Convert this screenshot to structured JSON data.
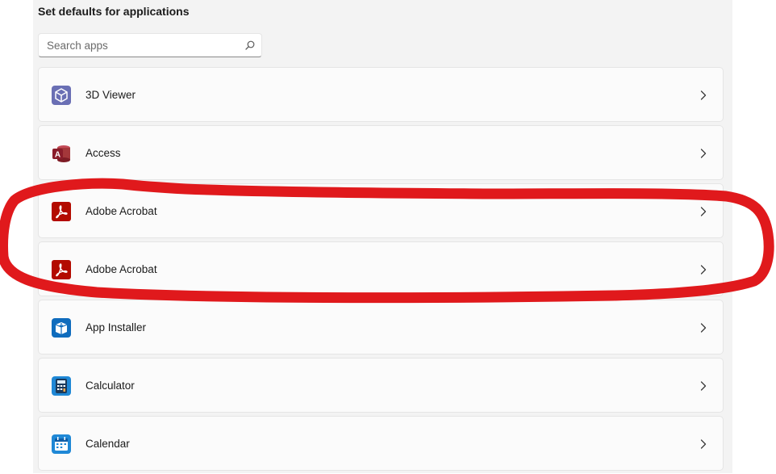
{
  "section_title": "Set defaults for applications",
  "search": {
    "placeholder": "Search apps",
    "icon": "search-icon"
  },
  "apps": [
    {
      "name": "3D Viewer",
      "icon": "3d-viewer-icon"
    },
    {
      "name": "Access",
      "icon": "access-icon"
    },
    {
      "name": "Adobe Acrobat",
      "icon": "acrobat-icon"
    },
    {
      "name": "Adobe Acrobat",
      "icon": "acrobat-icon"
    },
    {
      "name": "App Installer",
      "icon": "app-installer-icon"
    },
    {
      "name": "Calculator",
      "icon": "calculator-icon"
    },
    {
      "name": "Calendar",
      "icon": "calendar-icon"
    }
  ],
  "colors": {
    "panel_bg": "#f3f3f3",
    "row_bg": "#fbfbfb",
    "annotation_red": "#e0191c"
  }
}
